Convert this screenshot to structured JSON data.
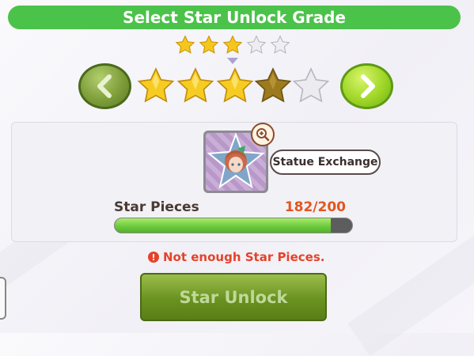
{
  "title": "Select Star Unlock Grade",
  "grade": {
    "selected": 3,
    "max": 5
  },
  "statue": {
    "exchange_label": "Statue Exchange"
  },
  "star_pieces": {
    "label": "Star Pieces",
    "count_text": "182/200",
    "current": 182,
    "required": 200
  },
  "warning": {
    "icon": "!",
    "text": "Not enough Star Pieces."
  },
  "unlock_button": {
    "label": "Star Unlock",
    "enabled": false
  },
  "colors": {
    "title_bar": "#4bc24a",
    "star_gold": "#f5c61c",
    "star_dim": "#9c7a1e",
    "star_empty": "#e9e9ee",
    "count_text": "#e4551e",
    "warning_text": "#e4432a"
  },
  "icons": {
    "prev": "chevron-left-icon",
    "next": "chevron-right-icon",
    "zoom": "magnify-plus-icon",
    "warning": "exclamation-circle-icon"
  }
}
